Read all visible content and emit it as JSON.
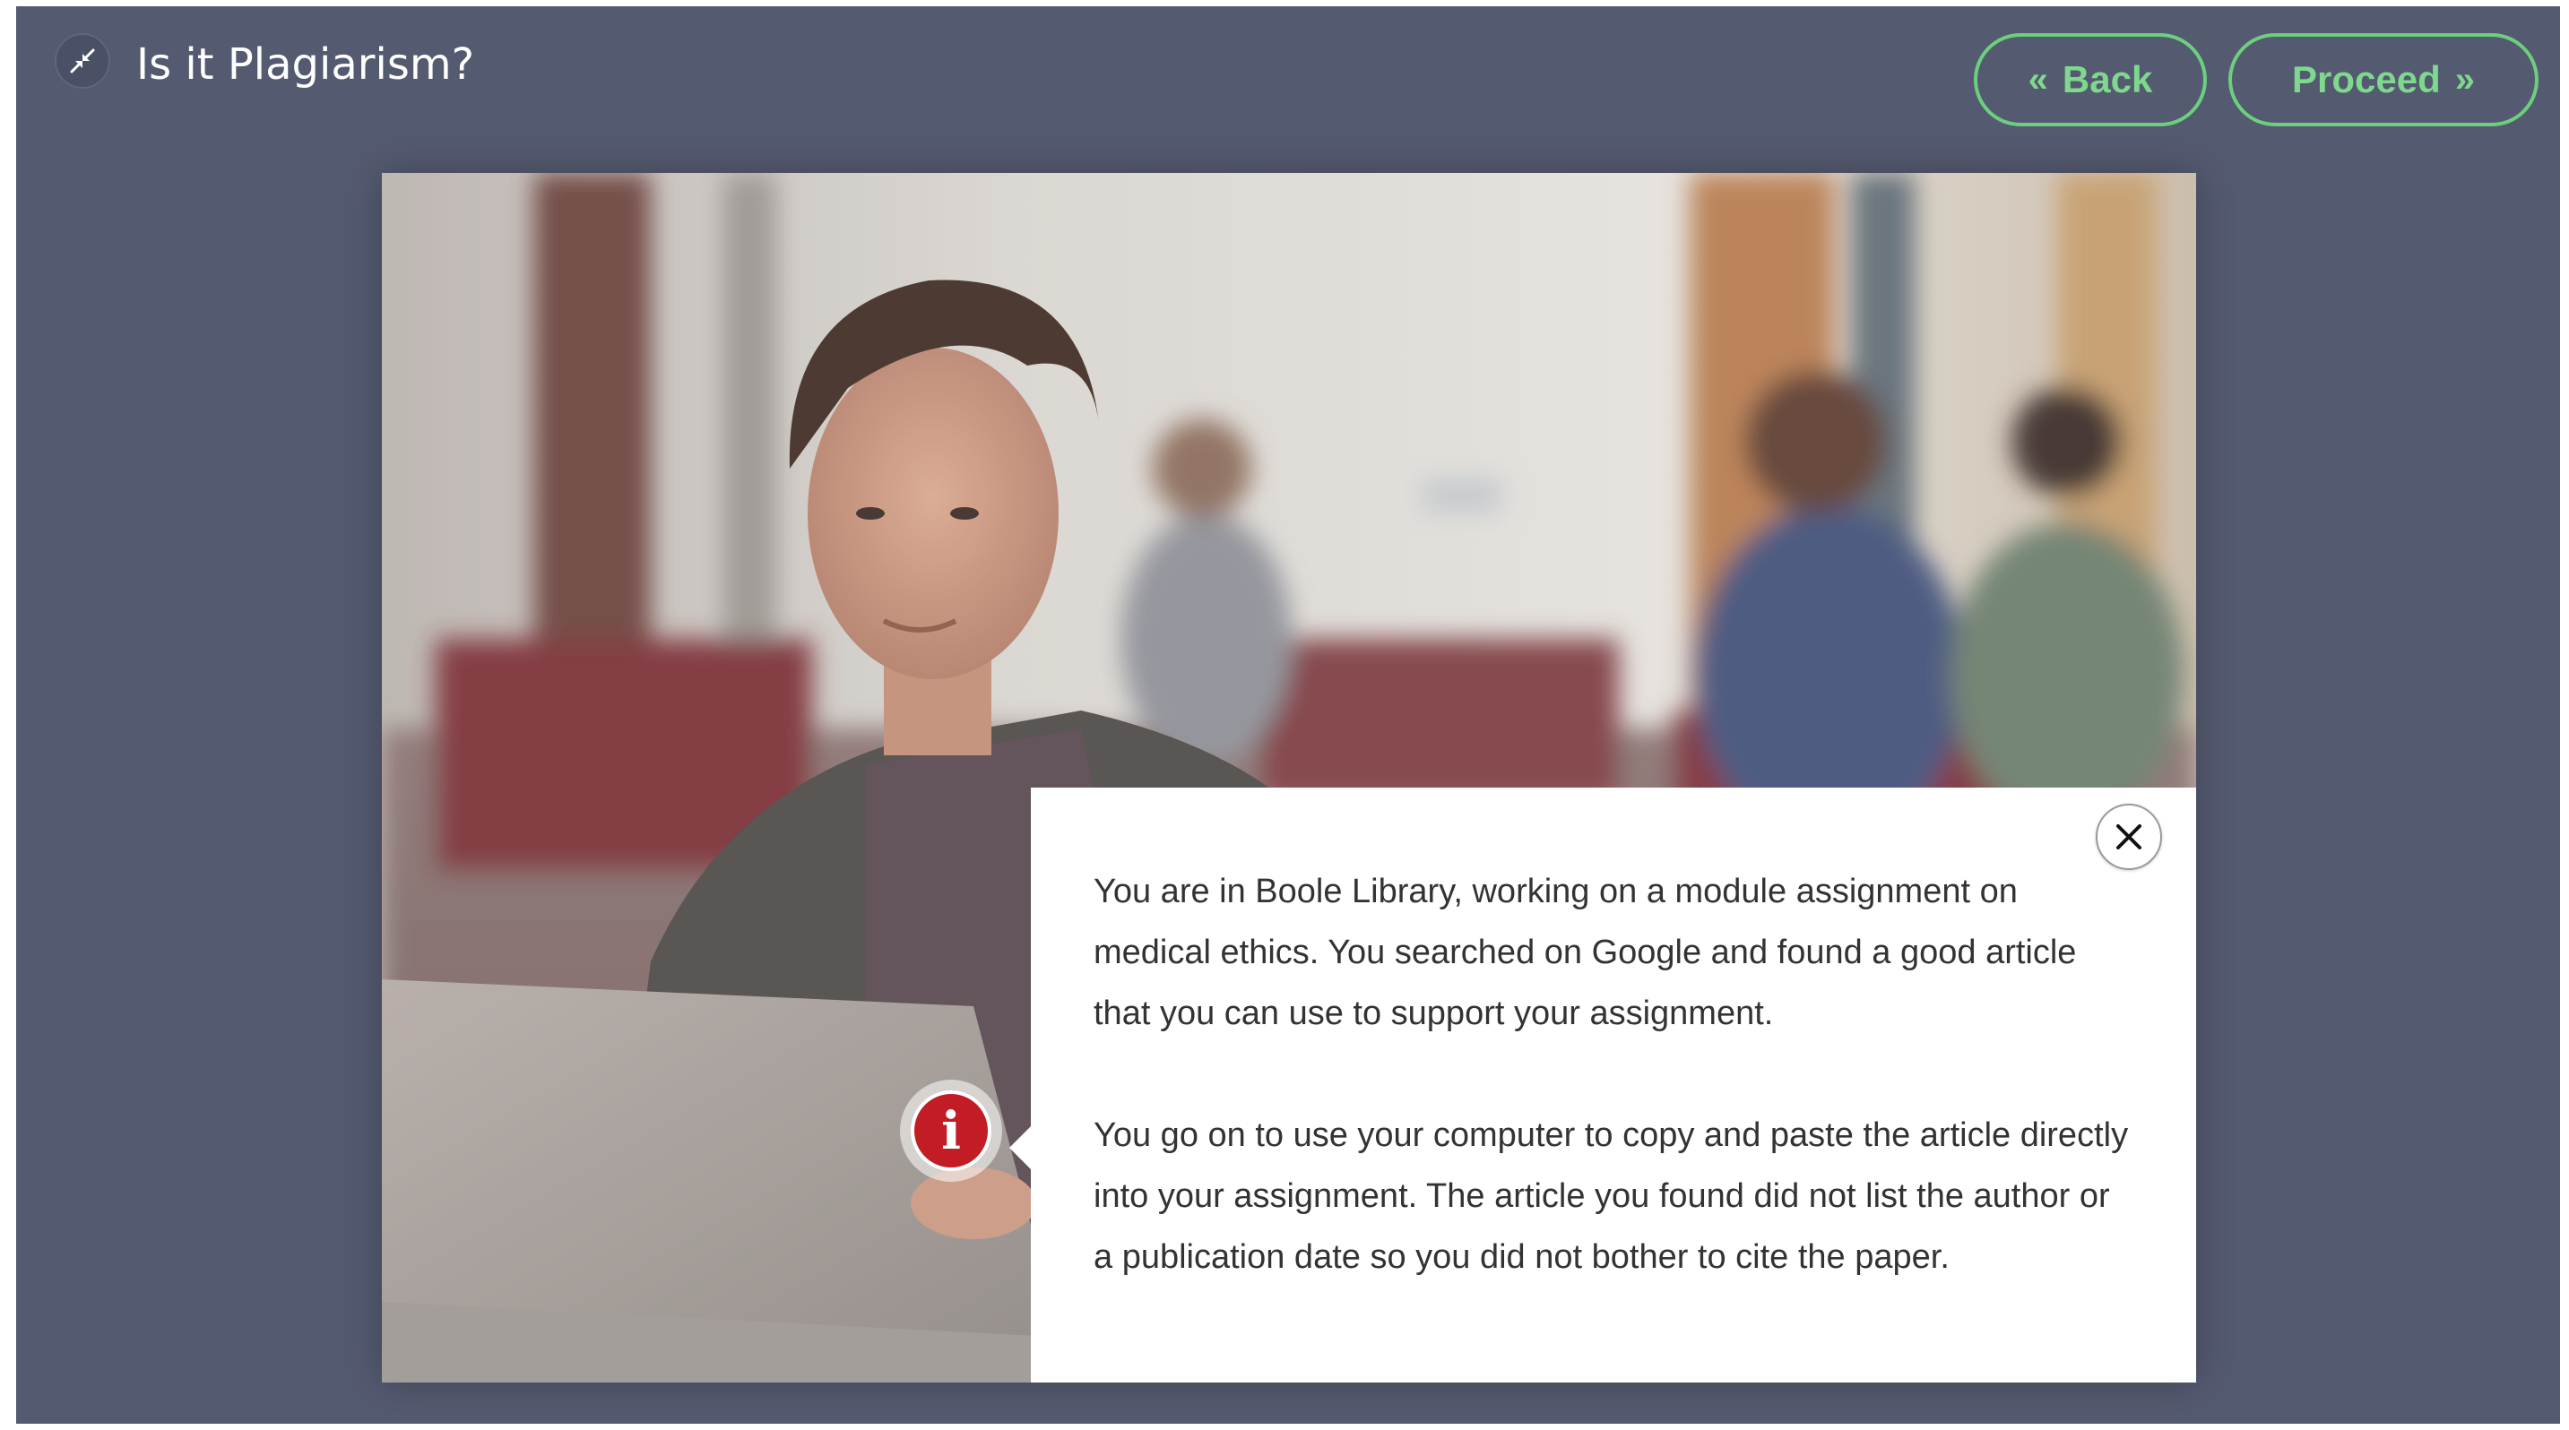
{
  "header": {
    "title": "Is it Plagiarism?",
    "exit_icon": "compress-arrows-icon",
    "back_label": "Back",
    "back_icon": "double-chevron-left-icon",
    "proceed_label": "Proceed",
    "proceed_icon": "double-chevron-right-icon"
  },
  "scene": {
    "hotspot_icon": "info-icon",
    "hotspot_glyph": "i"
  },
  "popup": {
    "close_icon": "close-icon",
    "paragraphs": [
      "You are in Boole Library, working on a module assignment on medical ethics. You searched on Google and found a good article that you can use to support your assignment.",
      "You go on to use your computer to copy and paste the article directly into your assignment. The article you found did not list the author or a publication date so you did not bother to cite the paper."
    ]
  },
  "colors": {
    "background": "#545a70",
    "button_accent": "#6ccf7e",
    "hotspot_red": "#c21c24"
  }
}
